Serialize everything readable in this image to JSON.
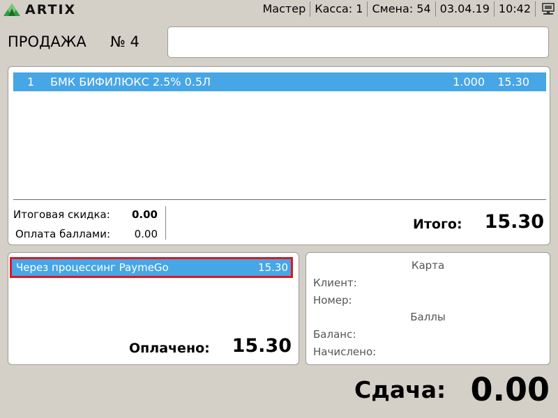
{
  "app": {
    "logo_text": "ARTIX"
  },
  "status_bar": {
    "role": "Мастер",
    "register": "Касса: 1",
    "shift": "Смена: 54",
    "date": "03.04.19",
    "time": "10:42",
    "terminal_icon": "terminal-icon"
  },
  "header": {
    "title": "ПРОДАЖА",
    "number": "№ 4",
    "scan_input_value": ""
  },
  "receipt": {
    "items": [
      {
        "index": "1",
        "name": "БМК БИФИЛЮКС 2.5% 0.5Л",
        "quantity": "1.000",
        "sum": "15.30"
      }
    ],
    "discount_label": "Итоговая скидка:",
    "discount_value": "0.00",
    "points_label": "Оплата баллами:",
    "points_value": "0.00",
    "total_label": "Итого:",
    "total_value": "15.30"
  },
  "payments": {
    "items": [
      {
        "name": "Через процессинг PaymeGo",
        "sum": "15.30"
      }
    ],
    "paid_label": "Оплачено:",
    "paid_value": "15.30"
  },
  "card": {
    "title": "Карта",
    "client_label": "Клиент:",
    "number_label": "Номер:",
    "points_title": "Баллы",
    "balance_label": "Баланс:",
    "accrued_label": "Начислено:"
  },
  "change": {
    "label": "Сдача:",
    "value": "0.00"
  },
  "colors": {
    "background": "#d4d0c8",
    "selection": "#47a6e6",
    "highlight_border": "#e0161d",
    "logo_green": "#2e9e3e"
  }
}
